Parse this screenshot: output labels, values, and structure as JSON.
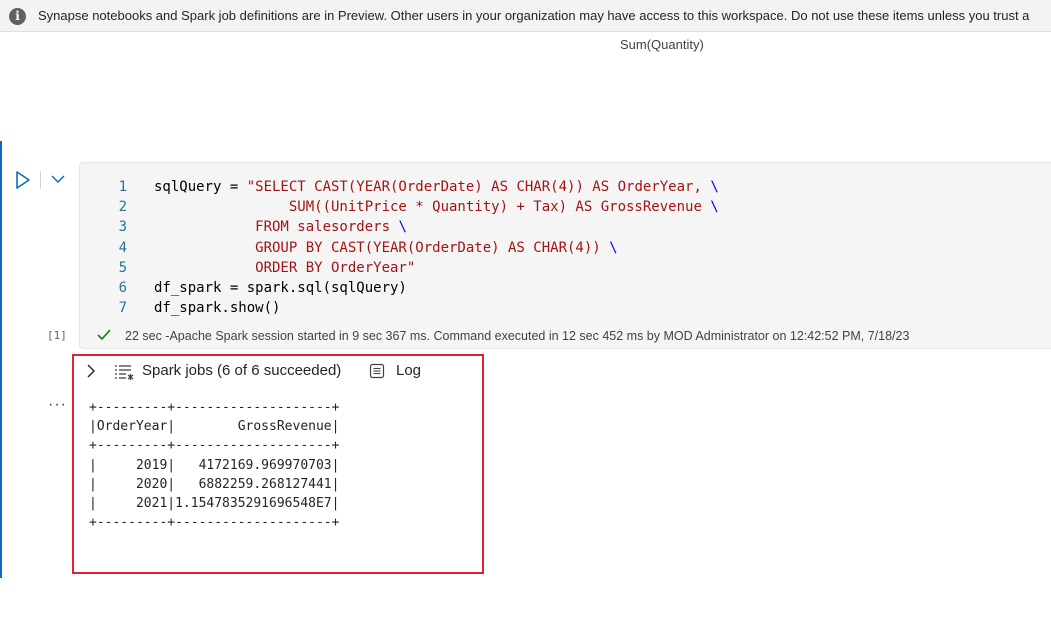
{
  "banner": {
    "info_icon": "info-icon",
    "text": "Synapse notebooks and Spark job definitions are in Preview. Other users in your organization may have access to this workspace. Do not use these items unless you trust a"
  },
  "previous_output": {
    "label": "Sum(Quantity)"
  },
  "cell": {
    "run_icon": "play-icon",
    "collapse_icon": "chevron-down-icon",
    "code_lines": [
      {
        "num": "1",
        "parts": [
          {
            "text": "sqlQuery = ",
            "cls": "txt"
          },
          {
            "text": "\"SELECT CAST(YEAR(OrderDate) AS CHAR(4)) AS OrderYear, ",
            "cls": "str"
          },
          {
            "text": "\\",
            "cls": "bs"
          }
        ]
      },
      {
        "num": "2",
        "parts": [
          {
            "text": "                SUM((UnitPrice * Quantity) + Tax) AS GrossRevenue ",
            "cls": "str"
          },
          {
            "text": "\\",
            "cls": "bs"
          }
        ]
      },
      {
        "num": "3",
        "parts": [
          {
            "text": "            FROM salesorders ",
            "cls": "str"
          },
          {
            "text": "\\",
            "cls": "bs"
          }
        ]
      },
      {
        "num": "4",
        "parts": [
          {
            "text": "            GROUP BY CAST(YEAR(OrderDate) AS CHAR(4)) ",
            "cls": "str"
          },
          {
            "text": "\\",
            "cls": "bs"
          }
        ]
      },
      {
        "num": "5",
        "parts": [
          {
            "text": "            ORDER BY OrderYear\"",
            "cls": "str"
          }
        ]
      },
      {
        "num": "6",
        "parts": [
          {
            "text": "df_spark = spark.sql(sqlQuery)",
            "cls": "txt"
          }
        ]
      },
      {
        "num": "7",
        "parts": [
          {
            "text": "df_spark.show()",
            "cls": "txt"
          }
        ]
      }
    ],
    "execution_count": "[1]",
    "status_icon": "check-icon",
    "status_text": "22 sec -Apache Spark session started in 9 sec 367 ms. Command executed in 12 sec 452 ms by MOD Administrator on 12:42:52 PM, 7/18/23"
  },
  "output": {
    "more_label": "···",
    "spark_jobs_label": "Spark jobs (6 of 6 succeeded)",
    "spark_jobs_icon": "list-icon",
    "log_label": "Log",
    "log_icon": "document-icon",
    "table_lines": [
      "+---------+--------------------+",
      "|OrderYear|        GrossRevenue|",
      "+---------+--------------------+",
      "|     2019|   4172169.969970703|",
      "|     2020|   6882259.268127441|",
      "|     2021|1.1547835291696548E7|",
      "+---------+--------------------+"
    ]
  },
  "colors": {
    "accent": "#0f6cbd",
    "highlight_border": "#e0232e",
    "success": "#107c10"
  }
}
